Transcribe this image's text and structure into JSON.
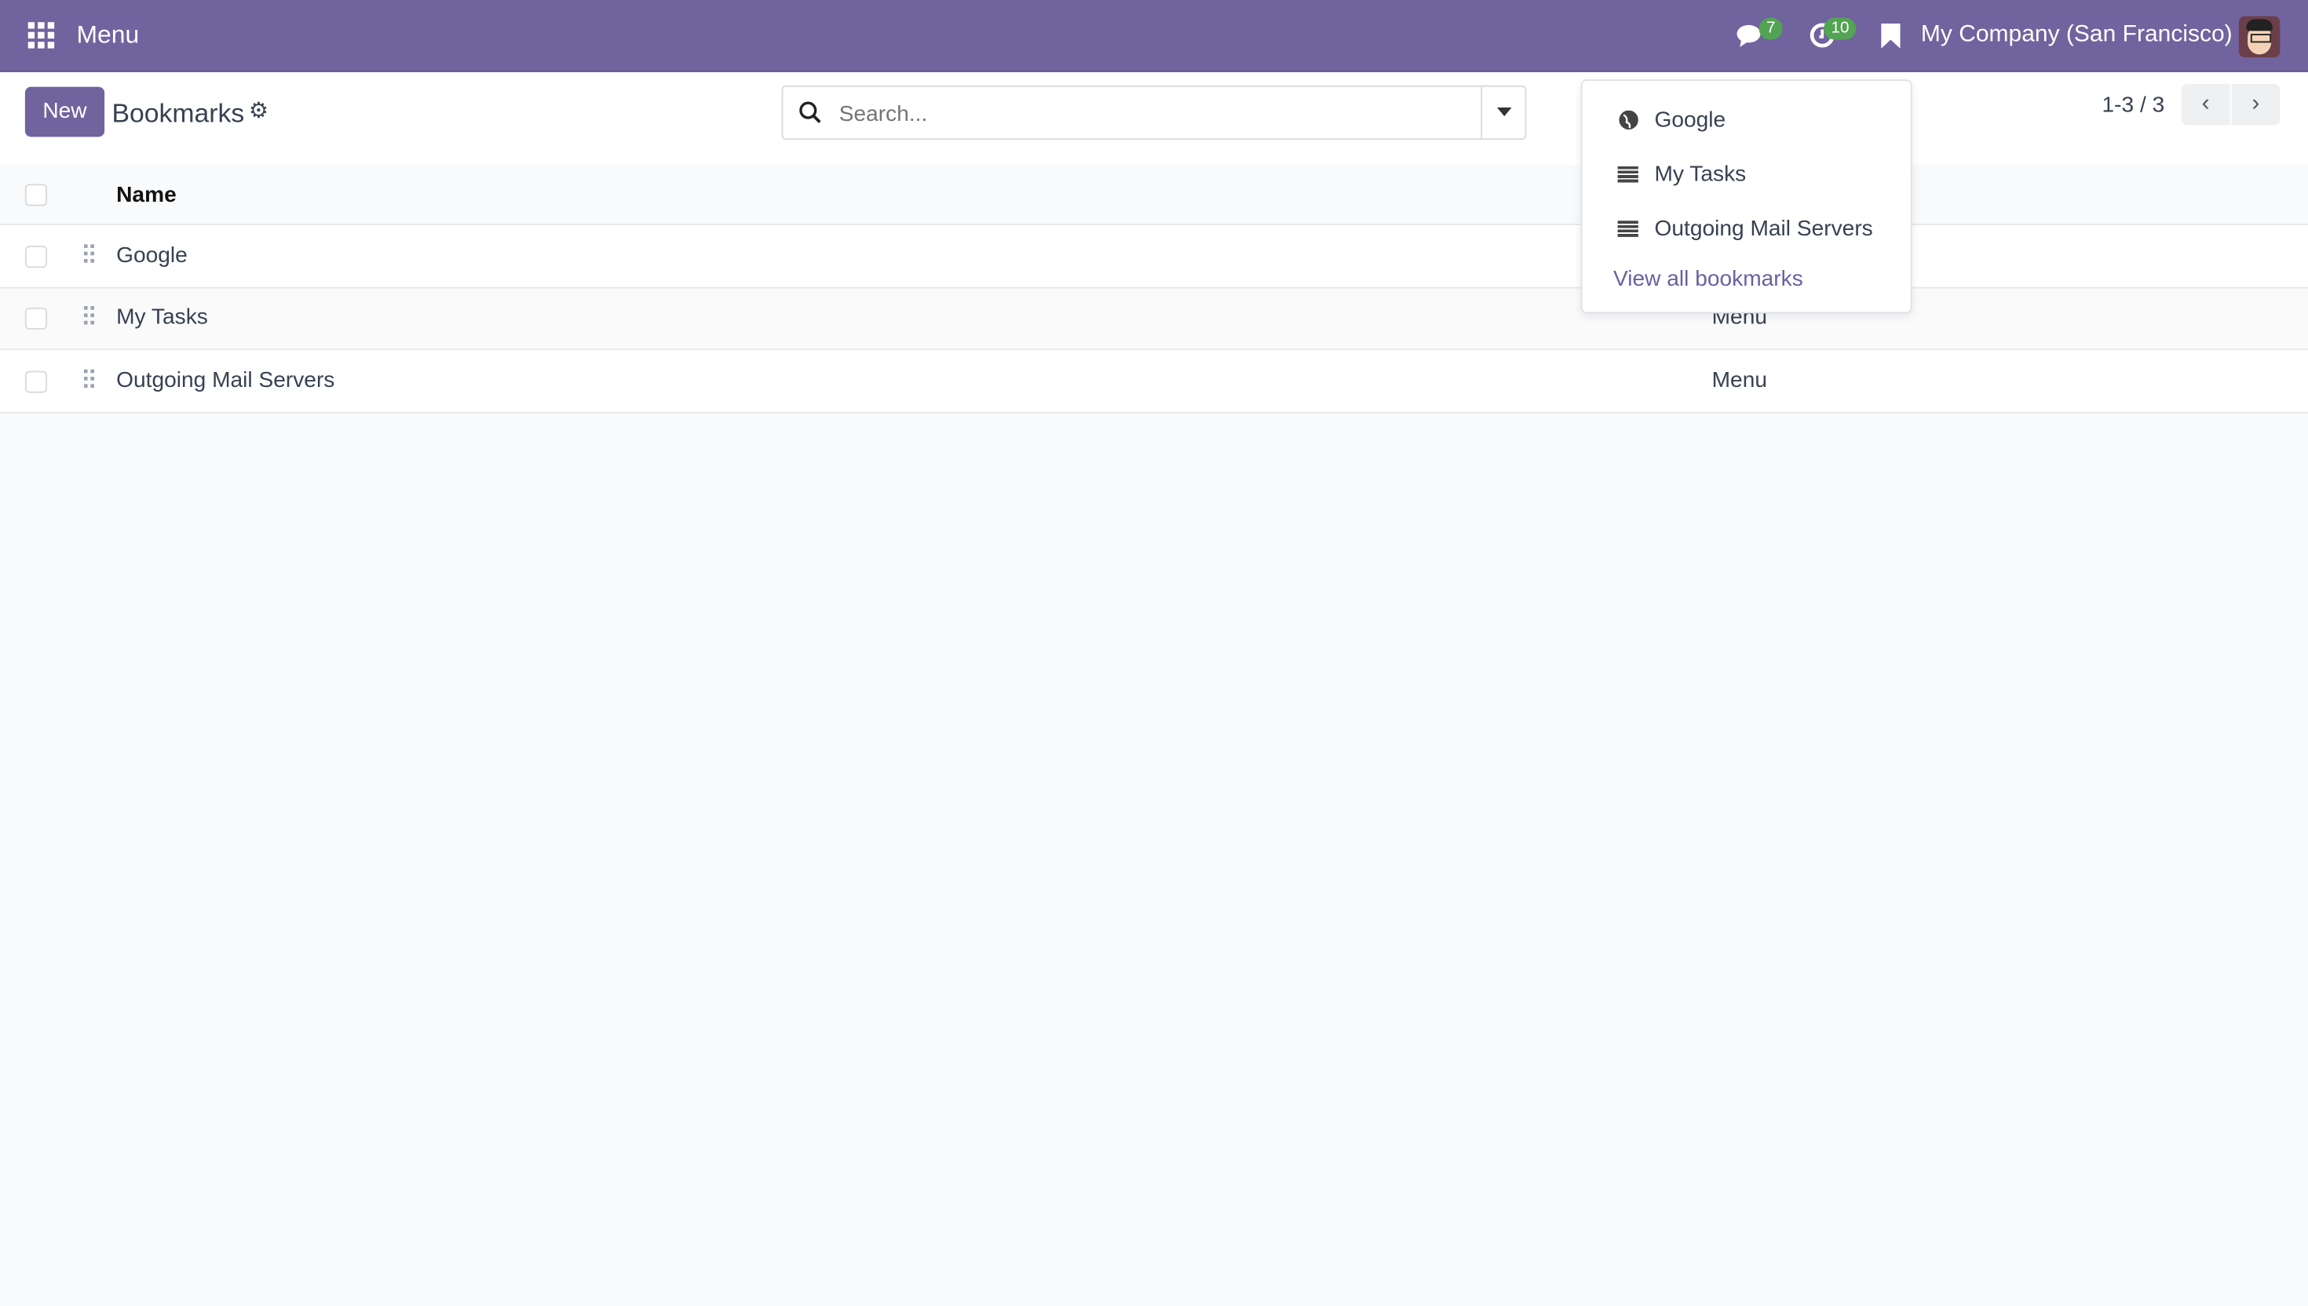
{
  "navbar": {
    "menu_label": "Menu",
    "messages_count": "7",
    "activities_count": "10",
    "company": "My Company (San Francisco)",
    "bg_color": "#71639e"
  },
  "control_panel": {
    "new_label": "New",
    "title": "Bookmarks",
    "search_placeholder": "Search...",
    "pager": "1-3 / 3"
  },
  "table": {
    "columns": [
      "Name",
      ""
    ],
    "rows": [
      {
        "name": "Google",
        "type": ""
      },
      {
        "name": "My Tasks",
        "type": "Menu"
      },
      {
        "name": "Outgoing Mail Servers",
        "type": "Menu"
      }
    ]
  },
  "bookmarks_dropdown": {
    "items": [
      {
        "label": "Google",
        "icon": "globe-icon"
      },
      {
        "label": "My Tasks",
        "icon": "list-icon"
      },
      {
        "label": "Outgoing Mail Servers",
        "icon": "list-icon"
      }
    ],
    "view_all": "View all bookmarks"
  }
}
